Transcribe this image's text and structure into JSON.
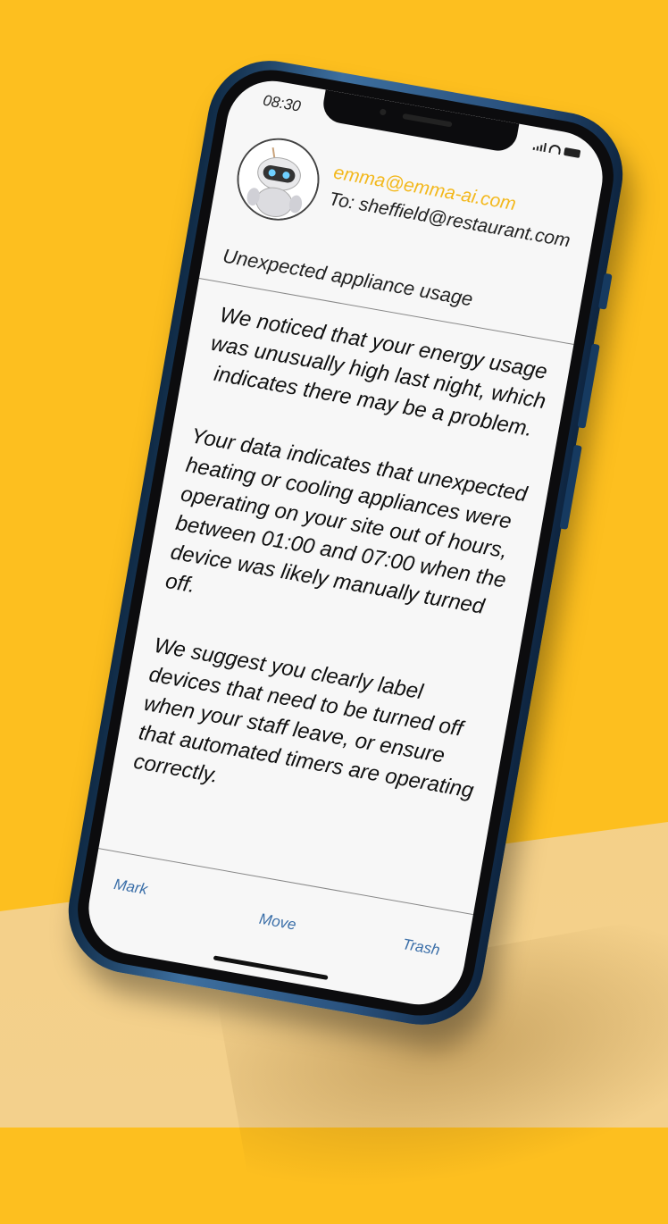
{
  "status_bar": {
    "time": "08:30"
  },
  "email": {
    "from": "emma@emma-ai.com",
    "to": "To: sheffield@restaurant.com",
    "subject": "Unexpected appliance usage",
    "paragraphs": [
      "We noticed that your energy usage was unusually high last night, which indicates there may be a problem.",
      "Your data indicates that unexpected heating or cooling appliances were operating on your site out of hours, between 01:00 and 07:00 when the device was likely manually turned off.",
      "We suggest you clearly label devices that need to be turned off when your staff leave, or ensure that automated timers are operating correctly."
    ]
  },
  "toolbar": {
    "mark": "Mark",
    "move": "Move",
    "trash": "Trash"
  },
  "colors": {
    "background": "#fdbf1f",
    "sender": "#f3b81c",
    "toolbar_link": "#3a6ea8",
    "phone": "#2a527e"
  },
  "icons": {
    "avatar": "robot-avatar-icon",
    "signal": "signal-icon",
    "wifi": "wifi-icon",
    "battery": "battery-icon"
  }
}
